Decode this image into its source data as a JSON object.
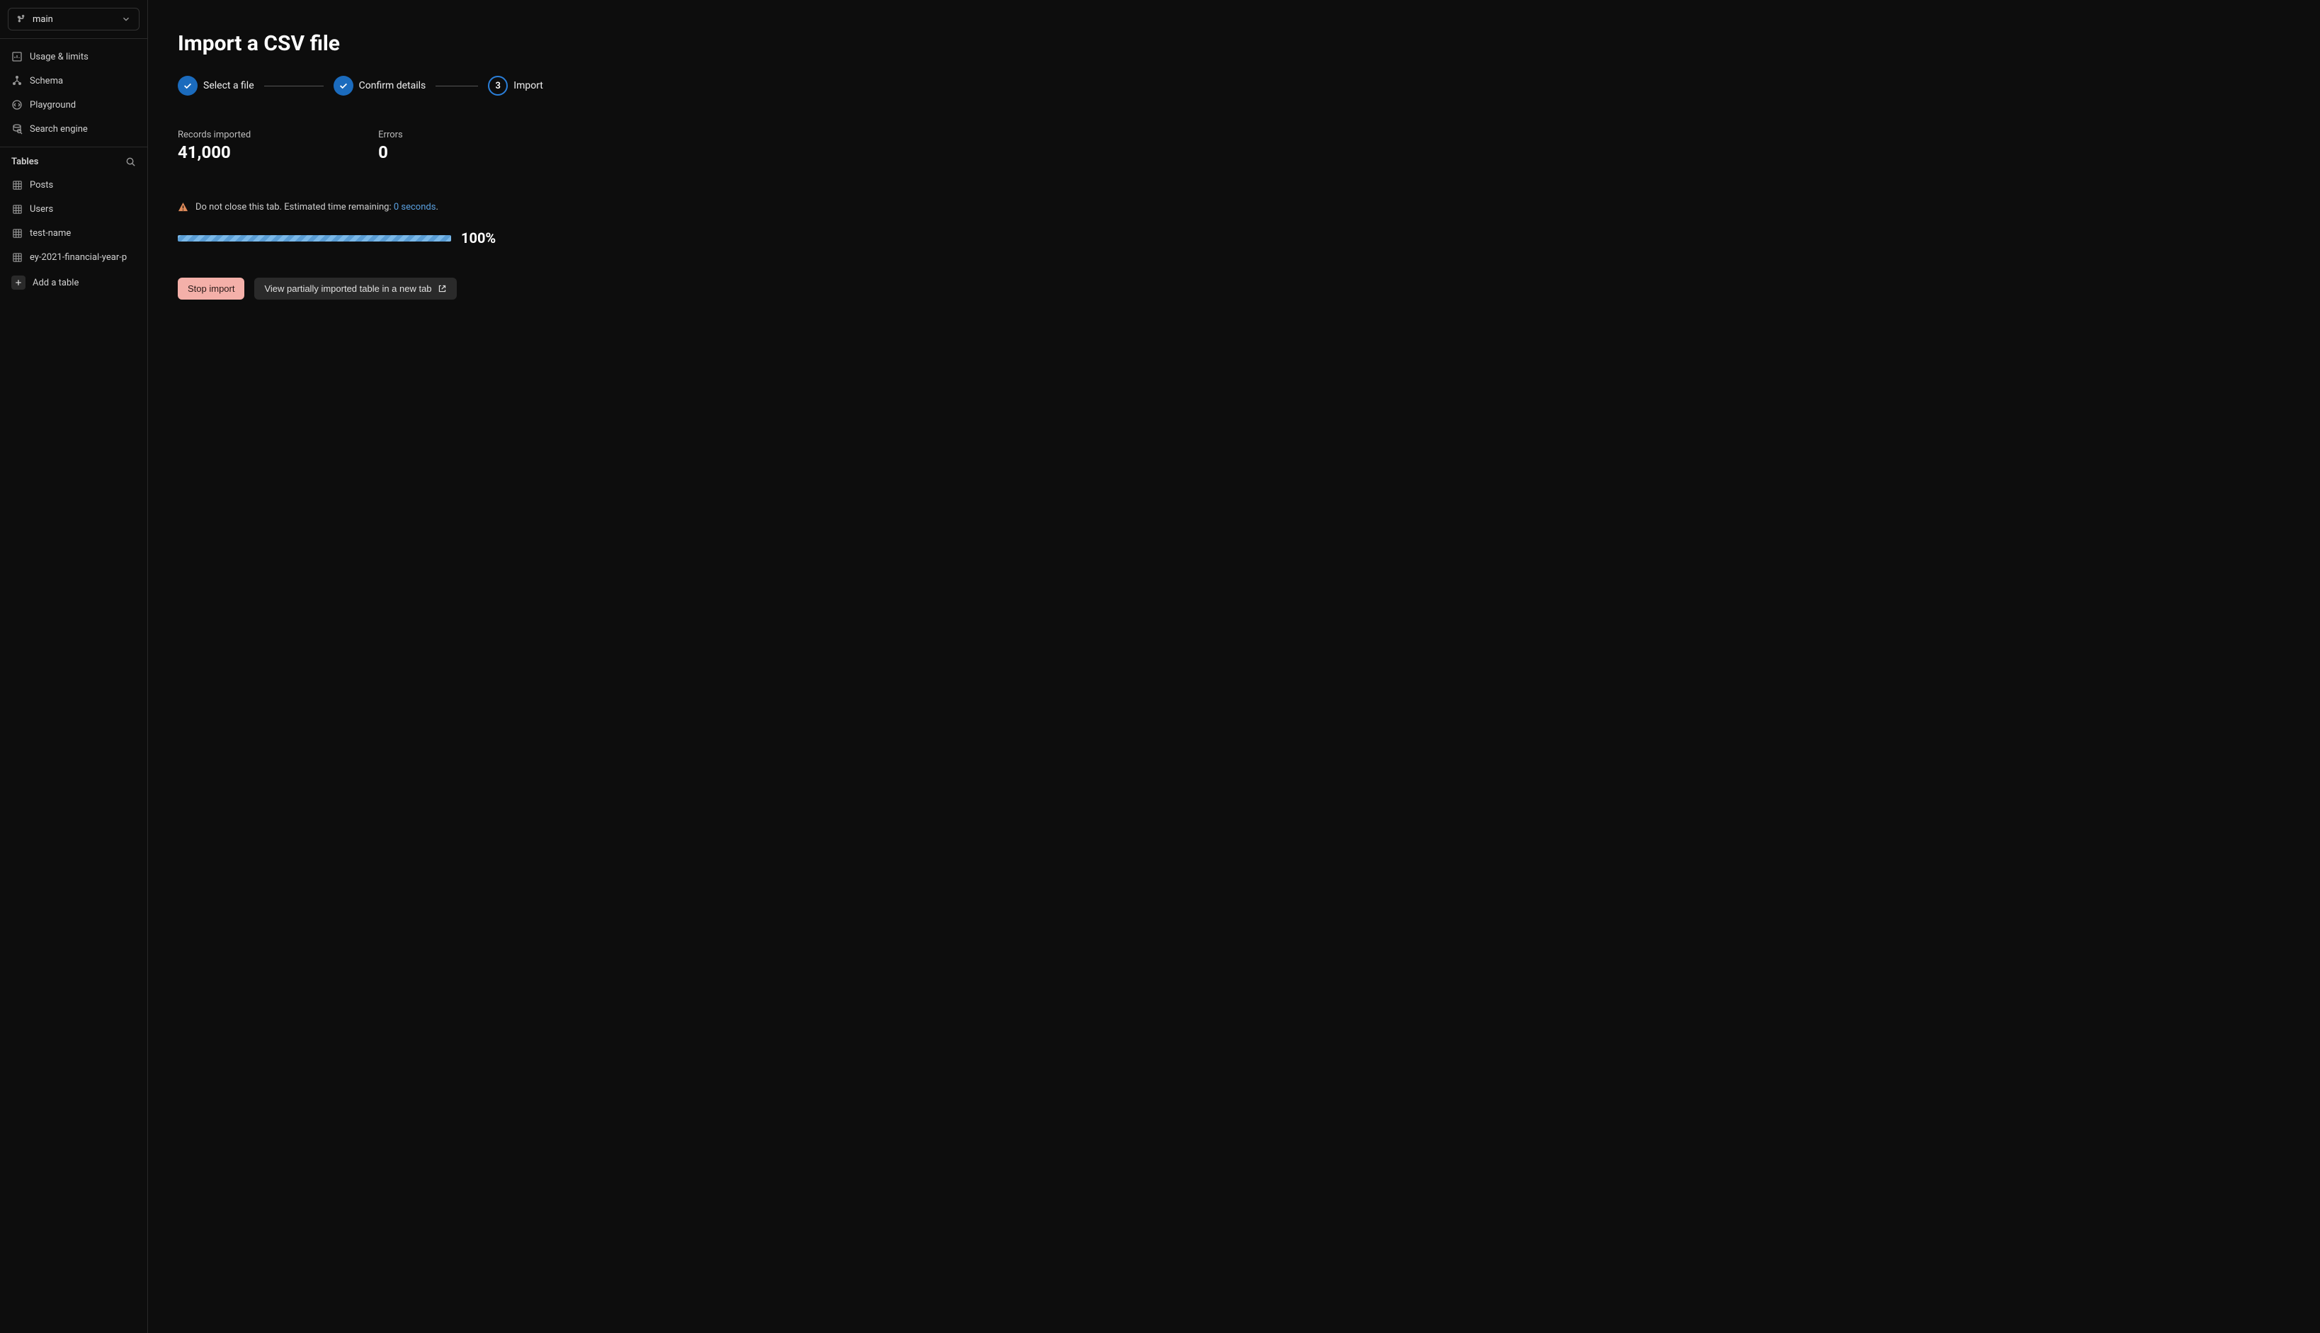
{
  "branch": {
    "name": "main"
  },
  "nav": {
    "items": [
      {
        "label": "Usage & limits"
      },
      {
        "label": "Schema"
      },
      {
        "label": "Playground"
      },
      {
        "label": "Search engine"
      }
    ]
  },
  "tables": {
    "header": "Tables",
    "items": [
      {
        "label": "Posts"
      },
      {
        "label": "Users"
      },
      {
        "label": "test-name"
      },
      {
        "label": "ey-2021-financial-year-p"
      }
    ],
    "add_label": "Add a table"
  },
  "page": {
    "title": "Import a CSV file",
    "steps": [
      {
        "label": "Select a file",
        "state": "done"
      },
      {
        "label": "Confirm details",
        "state": "done"
      },
      {
        "label": "Import",
        "state": "active",
        "number": "3"
      }
    ],
    "metrics": {
      "records_label": "Records imported",
      "records_value": "41,000",
      "errors_label": "Errors",
      "errors_value": "0"
    },
    "warning": {
      "prefix": "Do not close this tab. Estimated time remaining: ",
      "time": "0 seconds",
      "suffix": "."
    },
    "progress_percent": "100%",
    "buttons": {
      "stop": "Stop import",
      "view": "View partially imported table in a new tab"
    }
  }
}
